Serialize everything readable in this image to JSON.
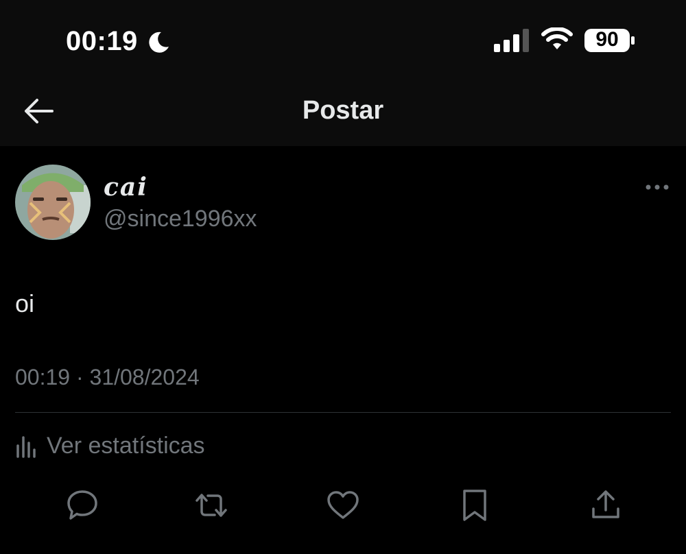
{
  "status_bar": {
    "time": "00:19",
    "battery": "90",
    "icons": [
      "moon-icon",
      "cellular-signal-icon",
      "wifi-icon",
      "battery-icon"
    ]
  },
  "header": {
    "title": "Postar",
    "back_icon": "arrow-left-icon"
  },
  "post": {
    "author": {
      "display_name": "cai",
      "handle": "@since1996xx"
    },
    "text": "oi",
    "timestamp": "00:19 · 31/08/2024",
    "more_icon": "ellipsis-icon"
  },
  "stats": {
    "label": "Ver estatísticas",
    "icon": "bar-chart-icon"
  },
  "actions": [
    {
      "name": "reply",
      "icon": "speech-bubble-icon"
    },
    {
      "name": "repost",
      "icon": "repost-icon"
    },
    {
      "name": "like",
      "icon": "heart-icon"
    },
    {
      "name": "bookmark",
      "icon": "bookmark-icon"
    },
    {
      "name": "share",
      "icon": "share-upload-icon"
    }
  ],
  "colors": {
    "background": "#000000",
    "header_background": "#0c0c0c",
    "primary_text": "#e7e9ea",
    "secondary_text": "#71767b",
    "divider": "#2f3336"
  }
}
